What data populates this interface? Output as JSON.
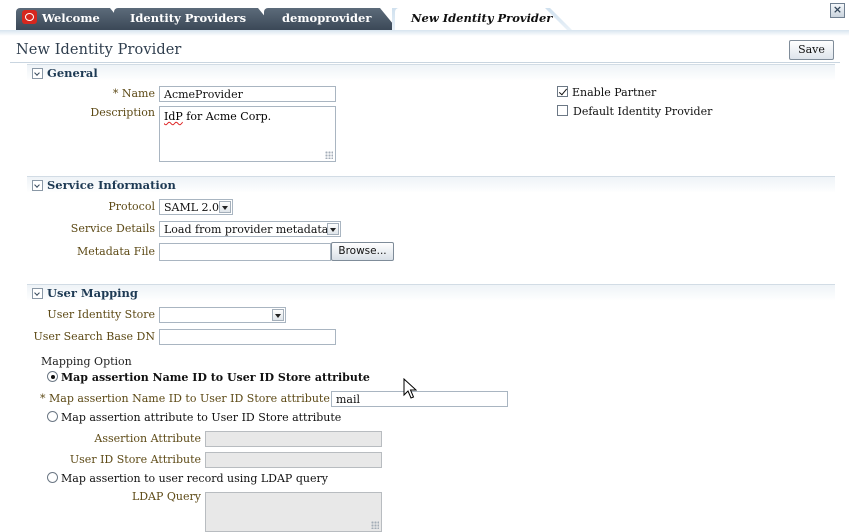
{
  "tabs": [
    {
      "label": "Welcome"
    },
    {
      "label": "Identity Providers"
    },
    {
      "label": "demoprovider"
    },
    {
      "label": "New Identity Provider"
    }
  ],
  "page": {
    "title": "New Identity Provider",
    "save_label": "Save"
  },
  "general": {
    "section_title": "General",
    "name_label": "Name",
    "name_value": "AcmeProvider",
    "description_label": "Description",
    "description_value_misspelled": "IdP",
    "description_value_rest": " for Acme Corp.",
    "enable_partner_label": "Enable Partner",
    "enable_partner_checked": true,
    "default_idp_label": "Default Identity Provider",
    "default_idp_checked": false
  },
  "service": {
    "section_title": "Service Information",
    "protocol_label": "Protocol",
    "protocol_value": "SAML 2.0",
    "details_label": "Service Details",
    "details_value": "Load from provider metadata",
    "metadata_label": "Metadata File",
    "metadata_value": "",
    "browse_label": "Browse..."
  },
  "mapping": {
    "section_title": "User Mapping",
    "identity_store_label": "User Identity Store",
    "identity_store_value": "",
    "search_base_label": "User Search Base DN",
    "search_base_value": "",
    "option_label": "Mapping Option",
    "opt1_label": "Map assertion Name ID to User ID Store attribute",
    "opt1_field_label": "Map assertion Name ID to User ID Store attribute",
    "opt1_field_value": "mail",
    "opt2_label": "Map assertion attribute to User ID Store attribute",
    "assertion_attr_label": "Assertion Attribute",
    "store_attr_label": "User ID Store Attribute",
    "opt3_label": "Map assertion to user record using LDAP query",
    "ldap_query_label": "LDAP Query",
    "selected_option": 1
  },
  "icons": {
    "logo": "oracle-logo-icon",
    "close": "close-icon",
    "disclose": "disclosure-triangle-icon",
    "cursor": "mouse-pointer-icon"
  },
  "colors": {
    "tab_dark": "#3b4857",
    "label_brown": "#5d4a16",
    "section_title": "#1e3a54",
    "title_text": "#2f3e4e"
  }
}
